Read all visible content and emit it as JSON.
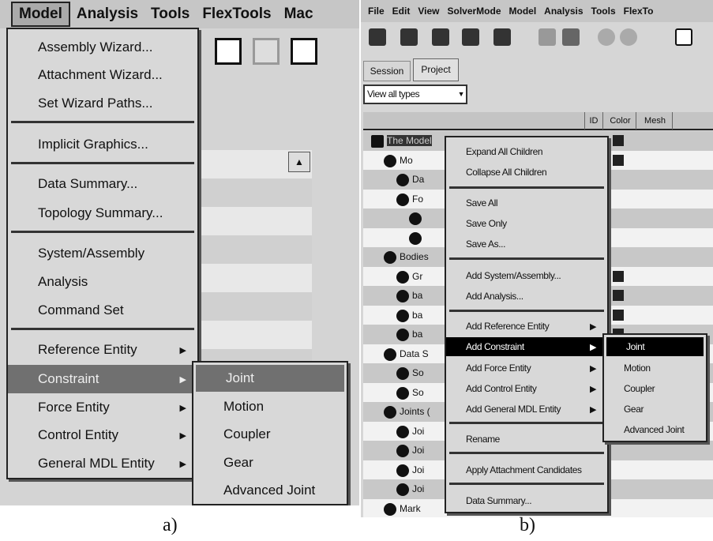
{
  "panel_a": {
    "menubar": [
      "Model",
      "Analysis",
      "Tools",
      "FlexTools",
      "Mac"
    ],
    "model_menu": [
      {
        "label": "Assembly Wizard..."
      },
      {
        "label": "Attachment Wizard..."
      },
      {
        "label": "Set Wizard Paths..."
      },
      {
        "label": "Implicit Graphics..."
      },
      {
        "label": "Data Summary..."
      },
      {
        "label": "Topology Summary..."
      },
      {
        "label": "System/Assembly"
      },
      {
        "label": "Analysis"
      },
      {
        "label": "Command Set"
      },
      {
        "label": "Reference Entity",
        "submenu": true
      },
      {
        "label": "Constraint",
        "submenu": true,
        "highlighted": true
      },
      {
        "label": "Force Entity",
        "submenu": true
      },
      {
        "label": "Control Entity",
        "submenu": true
      },
      {
        "label": "General MDL Entity",
        "submenu": true
      }
    ],
    "constraint_submenu": [
      "Joint",
      "Motion",
      "Coupler",
      "Gear",
      "Advanced Joint"
    ],
    "submenu_highlighted": "Joint",
    "caption": "a)"
  },
  "panel_b": {
    "menubar": [
      "File",
      "Edit",
      "View",
      "SolverMode",
      "Model",
      "Analysis",
      "Tools",
      "FlexTo"
    ],
    "tabs": [
      "Session",
      "Project"
    ],
    "active_tab": "Project",
    "filter_value": "View all types",
    "columns": [
      "ID",
      "Color",
      "Mesh"
    ],
    "tree": [
      "The Model",
      "Mo",
      "Da",
      "Fo",
      "",
      "",
      "Bodies",
      "Gr",
      "ba",
      "ba",
      "ba",
      "Data S",
      "So",
      "So",
      "Joints (",
      "Joi",
      "Joi",
      "Joi",
      "Joi",
      "Mark"
    ],
    "context_menu": [
      {
        "label": "Expand All Children"
      },
      {
        "label": "Collapse All Children"
      },
      {
        "label": "Save All"
      },
      {
        "label": "Save Only"
      },
      {
        "label": "Save As..."
      },
      {
        "label": "Add System/Assembly..."
      },
      {
        "label": "Add Analysis..."
      },
      {
        "label": "Add Reference Entity",
        "submenu": true
      },
      {
        "label": "Add Constraint",
        "submenu": true,
        "highlighted": true
      },
      {
        "label": "Add Force Entity",
        "submenu": true
      },
      {
        "label": "Add Control Entity",
        "submenu": true
      },
      {
        "label": "Add General MDL Entity",
        "submenu": true
      },
      {
        "label": "Rename"
      },
      {
        "label": "Apply Attachment Candidates"
      },
      {
        "label": "Data Summary..."
      }
    ],
    "constraint_submenu": [
      "Joint",
      "Motion",
      "Coupler",
      "Gear",
      "Advanced Joint"
    ],
    "submenu_highlighted": "Joint",
    "caption": "b)"
  }
}
